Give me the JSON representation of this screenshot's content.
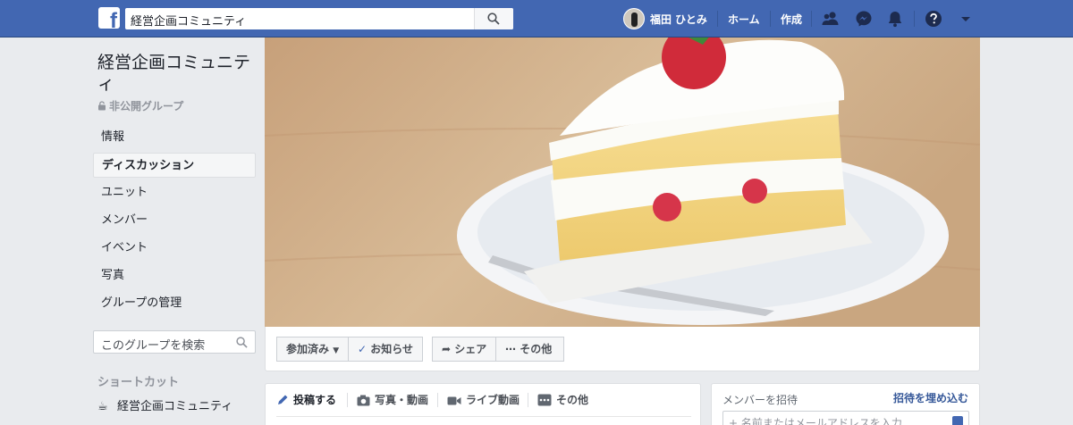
{
  "topbar": {
    "search_value": "経営企画コミュニティ",
    "user_name": "福田 ひとみ",
    "home": "ホーム",
    "create": "作成"
  },
  "group": {
    "title": "経営企画コミュニティ",
    "privacy": "非公開グループ"
  },
  "left_nav": {
    "items": [
      {
        "label": "情報"
      },
      {
        "label": "ディスカッション"
      },
      {
        "label": "ユニット"
      },
      {
        "label": "メンバー"
      },
      {
        "label": "イベント"
      },
      {
        "label": "写真"
      },
      {
        "label": "グループの管理"
      }
    ]
  },
  "group_search": {
    "placeholder": "このグループを検索"
  },
  "shortcuts": {
    "heading": "ショートカット",
    "items": [
      {
        "label": "経営企画コミュニティ"
      }
    ]
  },
  "actions": {
    "joined": "参加済み",
    "notifications": "お知らせ",
    "share": "シェア",
    "more": "その他"
  },
  "composer": {
    "tabs": [
      {
        "label": "投稿する"
      },
      {
        "label": "写真・動画"
      },
      {
        "label": "ライブ動画"
      },
      {
        "label": "その他"
      }
    ]
  },
  "invite": {
    "heading": "メンバーを招待",
    "embed_link": "招待を埋め込む",
    "placeholder": "+ 名前またはメールアドレスを入力..."
  },
  "colors": {
    "brand": "#4267b2",
    "link": "#365899",
    "page_bg": "#e9ebee"
  }
}
